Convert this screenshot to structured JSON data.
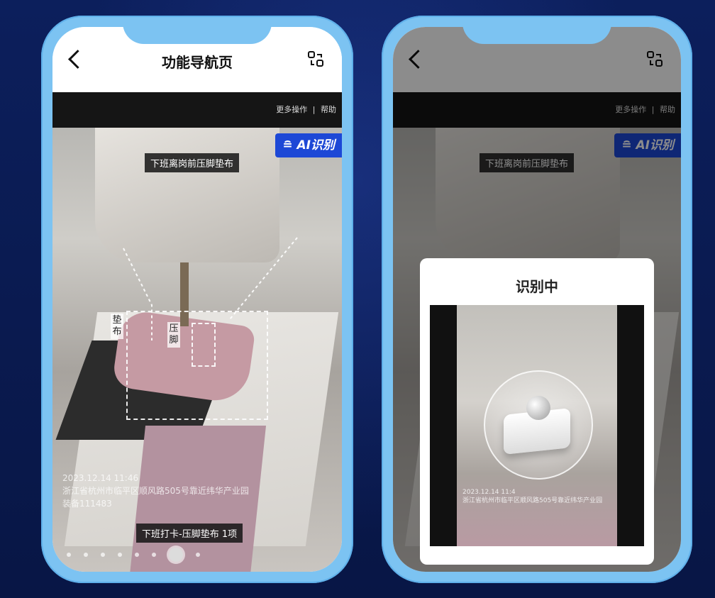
{
  "left_phone": {
    "title": "功能导航页",
    "more_actions": "更多操作",
    "separator": "|",
    "help": "帮助",
    "ai_badge": "AI识别",
    "top_label": "下班离岗前压脚垫布",
    "label_cloth": "垫布",
    "label_presser": "压脚",
    "watermark_time": "2023.12.14 11:46",
    "watermark_address": "浙江省杭州市临平区顺风路505号靠近纬华产业园",
    "watermark_device": "装备111483",
    "bottom_label": "下班打卡-压脚垫布 1项"
  },
  "right_phone": {
    "more_actions": "更多操作",
    "separator": "|",
    "help": "帮助",
    "ai_badge": "AI识别",
    "top_label": "下班离岗前压脚垫布",
    "modal_title": "识别中",
    "preview_watermark_time": "2023.12.14 11:4",
    "preview_watermark_address": "浙江省杭州市临平区顺风路505号靠近纬华产业园"
  },
  "icons": [
    "back-icon",
    "scan-icon",
    "ai-icon"
  ],
  "colors": {
    "phone_frame": "#7cc3f2",
    "ai_badge": "#1d48d6",
    "background": "#0b1a4a"
  }
}
